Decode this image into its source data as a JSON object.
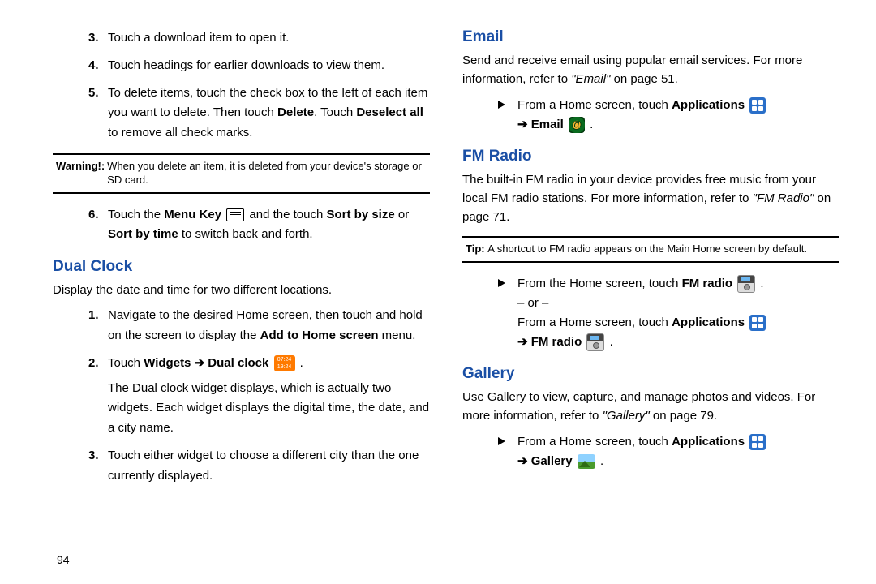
{
  "left": {
    "ol3": "Touch a download item to open it.",
    "ol4": "Touch headings for earlier downloads to view them.",
    "ol5_a": "To delete items, touch the check box to the left of each item you want to delete. Then touch ",
    "ol5_b1": "Delete",
    "ol5_c": ". Touch ",
    "ol5_b2": "Deselect all",
    "ol5_d": " to remove all check marks.",
    "warn_label": "Warning!: ",
    "warn_text": "When you delete an item, it is deleted from your device's storage or SD card.",
    "ol6_a": "Touch the ",
    "ol6_b1": "Menu Key",
    "ol6_b2": " and the touch ",
    "ol6_b3": "Sort by size",
    "ol6_b4": " or ",
    "ol6_b5": "Sort by time",
    "ol6_c": " to switch back and forth.",
    "h_dual": "Dual Clock",
    "dual_p": "Display the date and time for two different locations.",
    "d1_a": "Navigate to the desired Home screen, then touch and hold on the screen to display the ",
    "d1_b": "Add to Home screen",
    "d1_c": " menu.",
    "d2_a": "Touch ",
    "d2_b": "Widgets ➔ Dual clock",
    "d2_after": "The Dual clock widget displays, which is actually two widgets. Each widget displays the digital time, the date, and a city name.",
    "d3": "Touch either widget to choose a different city than the one currently displayed.",
    "dualclock_lines": "07:24\n19:24"
  },
  "right": {
    "h_email": "Email",
    "email_p_a": "Send and receive email using popular email services. For more information, refer to ",
    "email_p_i": "\"Email\" ",
    "email_p_b": " on page 51.",
    "email_step_a": "From a Home screen, touch ",
    "email_step_b": "Applications",
    "email_step_c": "➔ Email",
    "h_fm": "FM Radio",
    "fm_p_a": "The built-in FM radio in your device provides free music from your local FM radio stations. For more information, refer to ",
    "fm_p_i": "\"FM Radio\" ",
    "fm_p_b": " on page 71.",
    "tip_label": "Tip: ",
    "tip_text": "A shortcut to FM radio appears on the Main Home screen by default.",
    "fm_step1_a": "From the Home screen, touch ",
    "fm_step1_b": "FM radio",
    "fm_or": "– or –",
    "fm_step2_a": "From a Home screen, touch ",
    "fm_step2_b": "Applications",
    "fm_step2_c": "➔ FM radio",
    "h_gallery": "Gallery",
    "gal_p_a": "Use Gallery to view, capture, and manage photos and videos. For more information, refer to ",
    "gal_p_i": "\"Gallery\" ",
    "gal_p_b": " on page 79.",
    "gal_step_a": "From a Home screen, touch ",
    "gal_step_b": "Applications",
    "gal_step_c": "➔ Gallery"
  },
  "page_number": "94"
}
